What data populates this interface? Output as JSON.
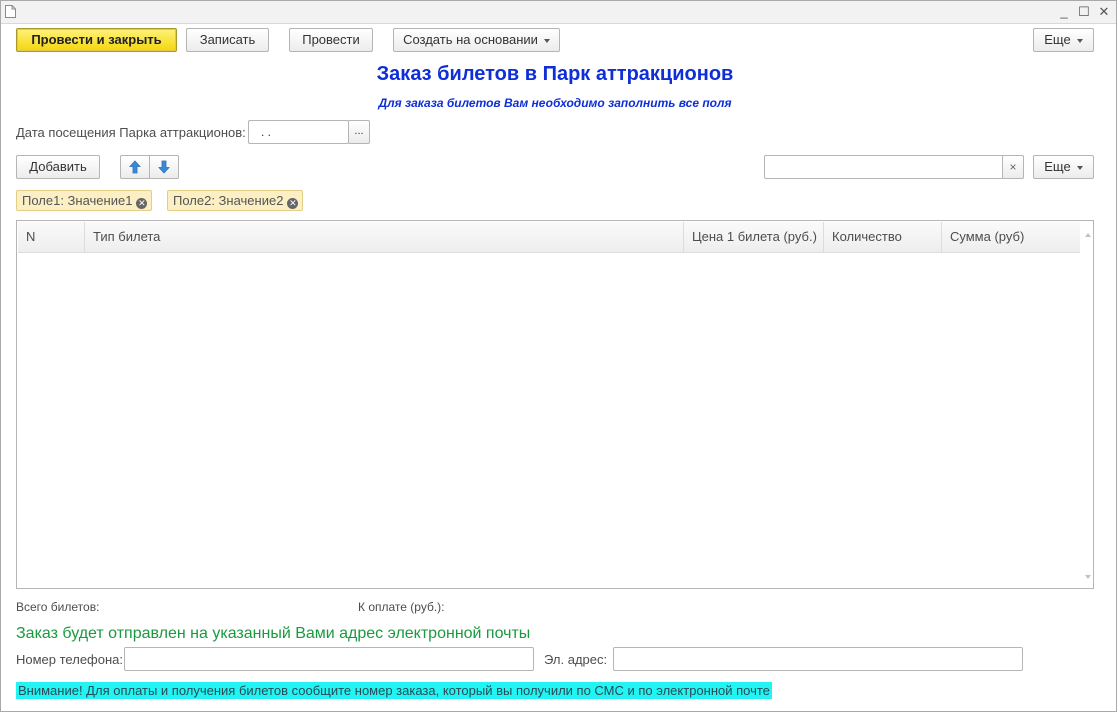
{
  "toolbar": {
    "post_close": "Провести и закрыть",
    "save": "Записать",
    "post": "Провести",
    "create_based_on": "Создать на основании",
    "more": "Еще"
  },
  "window": {
    "minimize": "_",
    "maximize": "☐",
    "close": "✕"
  },
  "header": {
    "title": "Заказ билетов в Парк аттракционов",
    "subtitle": "Для заказа билетов Вам необходимо заполнить все поля"
  },
  "visit_date": {
    "label": "Дата посещения Парка аттракционов:",
    "value": ". .",
    "choose_button": "..."
  },
  "table_toolbar": {
    "add": "Добавить",
    "up_icon": "arrow-up-icon",
    "down_icon": "arrow-down-icon",
    "search_value": "",
    "clear": "×",
    "more": "Еще"
  },
  "filters": [
    {
      "label": "Поле1: Значение1"
    },
    {
      "label": "Поле2: Значение2"
    }
  ],
  "table": {
    "columns": [
      "N",
      "Тип билета",
      "Цена 1 билета (руб.)",
      "Количество",
      "Сумма (руб)"
    ],
    "rows": []
  },
  "totals": {
    "tickets_label": "Всего билетов:",
    "to_pay_label": "К оплате (руб.):"
  },
  "contact": {
    "note": "Заказ будет отправлен на указанный Вами адрес электронной почты",
    "phone_label": "Номер телефона:",
    "phone_value": "",
    "email_label": "Эл. адрес:",
    "email_value": ""
  },
  "warning": "Внимание! Для оплаты и получения билетов сообщите номер заказа, который вы получили по СМС и по электронной почте",
  "colors": {
    "title": "#0e2ed8",
    "primary_button": "#f4d60d",
    "note_green": "#1a9a3e",
    "warning_bg": "#22f4f4"
  }
}
